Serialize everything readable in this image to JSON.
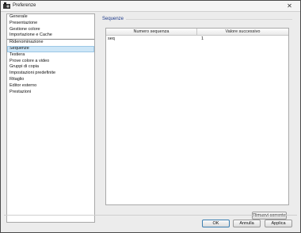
{
  "window": {
    "title": "Preferenze",
    "close_glyph": "✕"
  },
  "sidebar": {
    "items": [
      {
        "label": "Generale"
      },
      {
        "label": "Presentazione"
      },
      {
        "label": "Gestione colore"
      },
      {
        "label": "Importazione e Cache"
      },
      {
        "label": "Ridenominazione"
      },
      {
        "label": "Sequenze",
        "selected": true
      },
      {
        "label": "Testiera"
      },
      {
        "label": "Prove colore a video"
      },
      {
        "label": "Gruppi di copia"
      },
      {
        "label": "Impostazioni predefinite"
      },
      {
        "label": "Ritaglio"
      },
      {
        "label": "Editor esterno"
      },
      {
        "label": "Prestazioni"
      }
    ]
  },
  "section": {
    "title": "Sequenze"
  },
  "table": {
    "columns": [
      "Numero sequenza",
      "Valore successivo"
    ],
    "rows": [
      {
        "name": "seq",
        "value": "1"
      }
    ]
  },
  "buttons": {
    "remove": "Rimuovi corrente",
    "ok": "OK",
    "cancel": "Annulla",
    "apply": "Applica"
  },
  "colors": {
    "selection": "#cde6f7",
    "section_title": "#1e3a8a"
  }
}
